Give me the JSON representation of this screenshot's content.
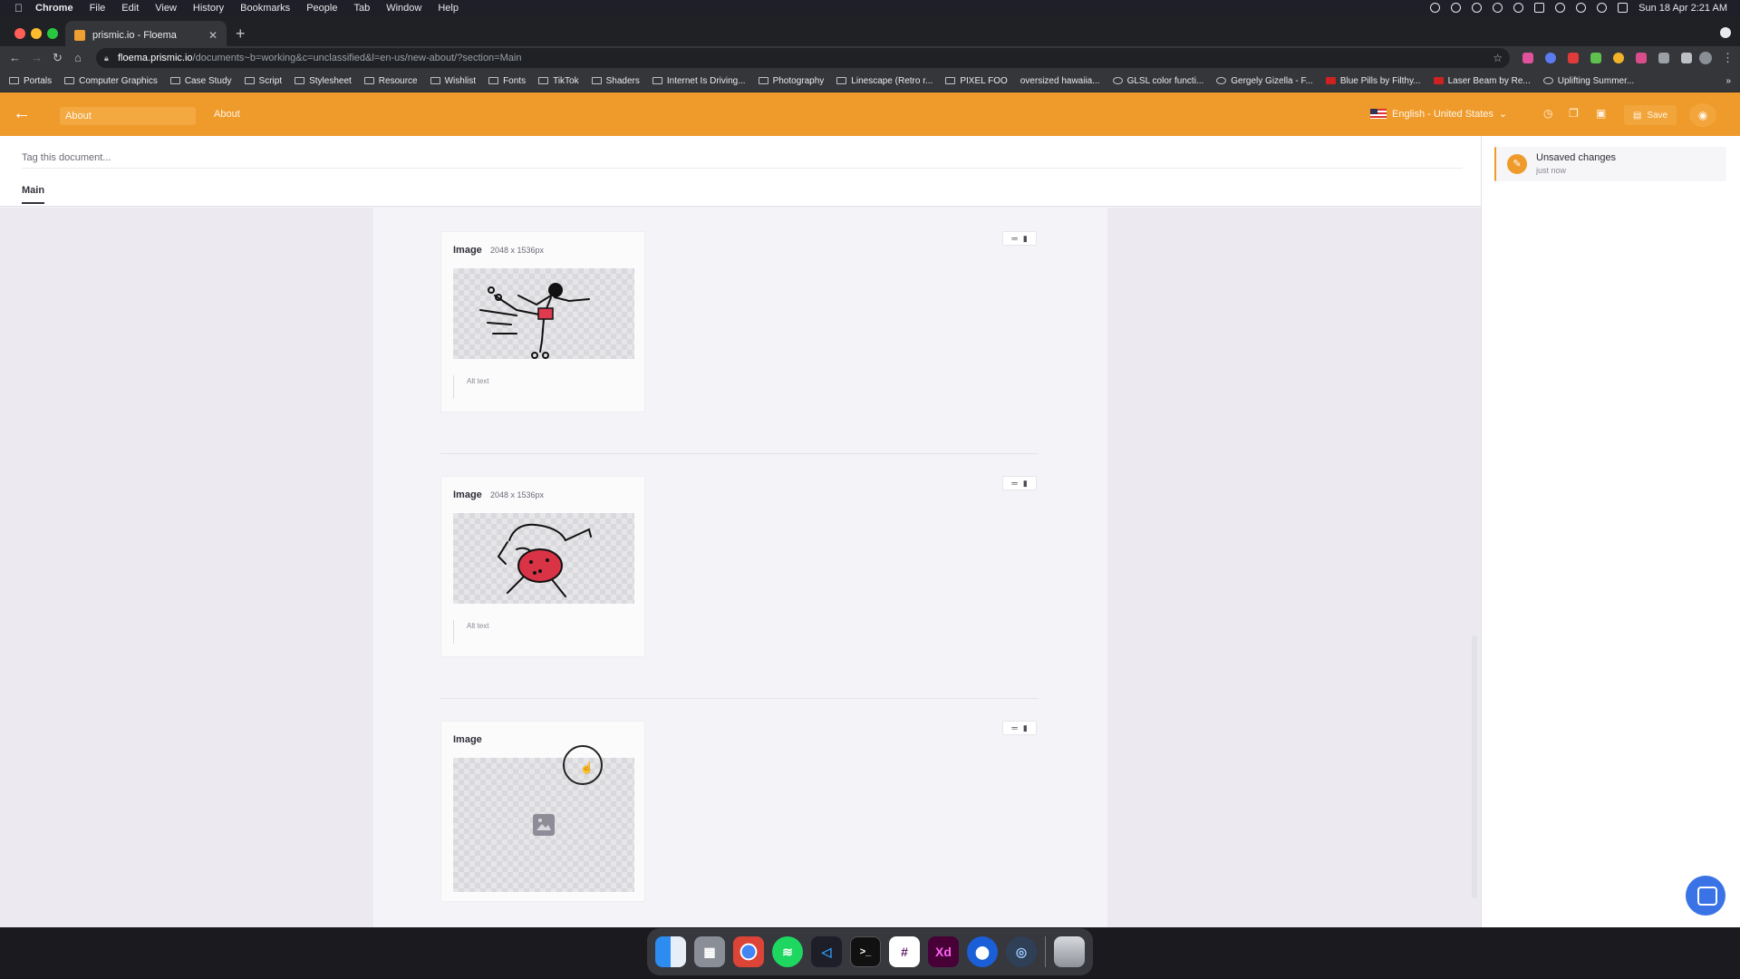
{
  "menubar": {
    "app": "Chrome",
    "items": [
      "File",
      "Edit",
      "View",
      "History",
      "Bookmarks",
      "People",
      "Tab",
      "Window",
      "Help"
    ],
    "clock": "Sun 18 Apr  2:21 AM"
  },
  "browser": {
    "tab_title": "prismic.io - Floema",
    "url_host": "floema.prismic.io",
    "url_path": "/documents~b=working&c=unclassified&l=en-us/new-about/?section=Main",
    "bookmarks": [
      "Portals",
      "Computer Graphics",
      "Case Study",
      "Script",
      "Stylesheet",
      "Resource",
      "Wishlist",
      "Fonts",
      "TikTok",
      "Shaders",
      "Internet Is Driving...",
      "Photography",
      "Linescape (Retro r...",
      "PIXEL FOO",
      "oversized hawaiia...",
      "GLSL color functi...",
      "Gergely Gizella - F...",
      "Blue Pills by Filthy...",
      "Laser Beam by Re...",
      "Uplifting Summer..."
    ],
    "bookmark_overflow": "»"
  },
  "appbar": {
    "title_value": "About",
    "title_label": "About",
    "locale": "English - United States",
    "save_label": "Save",
    "accent": "#ef9b2c"
  },
  "document": {
    "tag_placeholder": "Tag this document...",
    "tab_main": "Main"
  },
  "fields": [
    {
      "title": "Image",
      "dims": "2048 x 1536px",
      "alt_placeholder": "Alt text",
      "figure": "skater"
    },
    {
      "title": "Image",
      "dims": "2048 x 1536px",
      "alt_placeholder": "Alt text",
      "figure": "dancer"
    },
    {
      "title": "Image",
      "dims": "",
      "alt_placeholder": "",
      "figure": "empty"
    }
  ],
  "status": {
    "title": "Unsaved changes",
    "time": "just now"
  },
  "dock": {
    "apps": [
      "finder",
      "launchpad",
      "chrome",
      "spotify",
      "vscode",
      "terminal",
      "slack",
      "xd",
      "pin",
      "quicktime",
      "trash"
    ],
    "xd_label": "Xd"
  }
}
